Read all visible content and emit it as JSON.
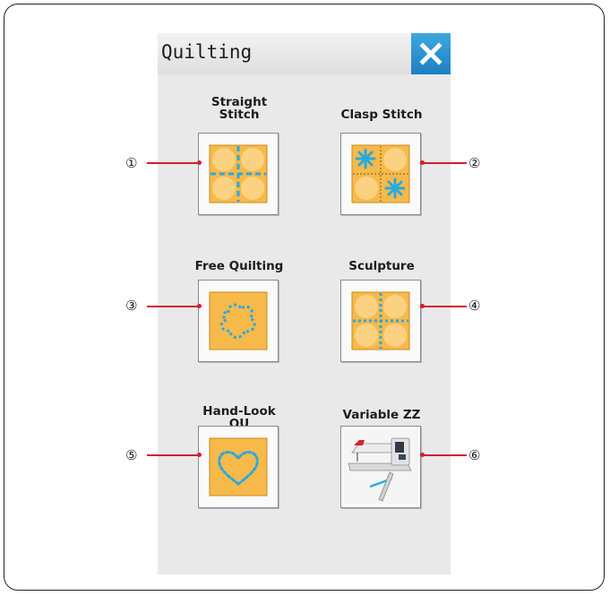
{
  "header": {
    "title": "Quilting",
    "close_icon": "close-icon"
  },
  "buttons": [
    {
      "label": "Straight\nStitch",
      "callout": "①",
      "icon": "straight-stitch-icon"
    },
    {
      "label": "Clasp Stitch",
      "callout": "②",
      "icon": "clasp-stitch-icon"
    },
    {
      "label": "Free Quilting",
      "callout": "③",
      "icon": "free-quilting-icon"
    },
    {
      "label": "Sculpture",
      "callout": "④",
      "icon": "sculpture-icon"
    },
    {
      "label": "Hand-Look\nQU",
      "callout": "⑤",
      "icon": "hand-look-quilting-icon"
    },
    {
      "label": "Variable ZZ",
      "callout": "⑥",
      "icon": "sewing-machine-knee-lifter-icon"
    }
  ],
  "colors": {
    "fabric": "#f7b94a",
    "fabric_light": "#fbd890",
    "stitch": "#27a9e1",
    "close_bg": "#2b93d3",
    "leader": "#d21e2b",
    "panel_bg": "#e9e9e9"
  }
}
